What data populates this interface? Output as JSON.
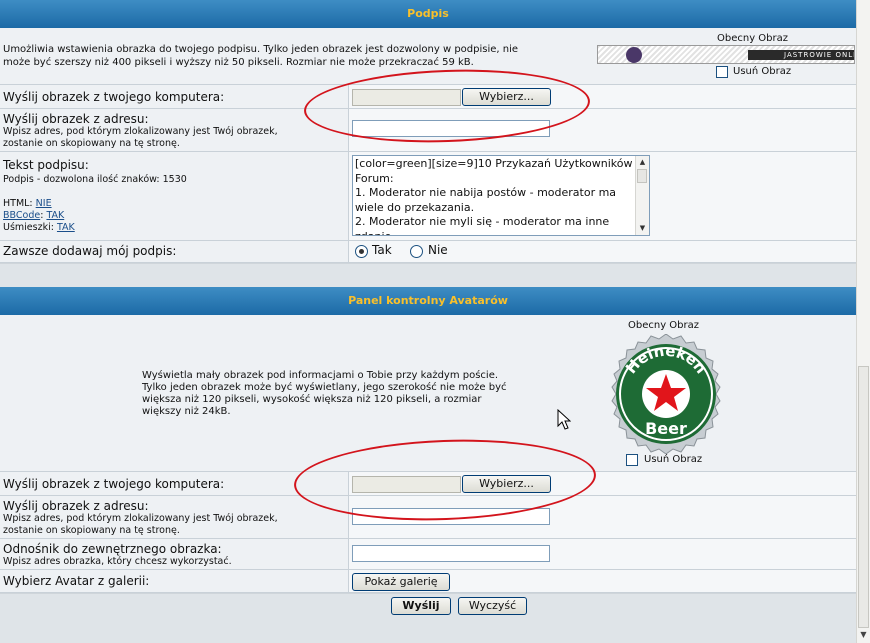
{
  "signature": {
    "header": "Podpis",
    "description_line1": "Umożliwia wstawienia obrazka do twojego podpisu. Tylko jeden obrazek jest dozwolony w podpisie, nie",
    "description_line2": "może być szerszy niż 400 pikseli i wyższy niż 50 pikseli. Rozmiar nie może przekraczać 59 kB.",
    "current_image_label": "Obecny Obraz",
    "banner_text": "JASTROWIE ONLINE",
    "remove_image_label": "Usuń Obraz",
    "upload_label": "Wyślij obrazek z twojego komputera:",
    "browse_label": "Wybierz...",
    "url_label": "Wyślij obrazek z adresu:",
    "url_help_line1": "Wpisz adres, pod którym zlokalizowany jest Twój obrazek,",
    "url_help_line2": "zostanie on skopiowany na tę stronę.",
    "url_value": "",
    "text_label": "Tekst podpisu:",
    "char_limit": "Podpis - dozwolona ilość znaków: 1530",
    "html_label": "HTML:",
    "html_value": "NIE",
    "bbcode_label": "BBCode",
    "bbcode_value": "TAK",
    "smilies_label": "Uśmieszki:",
    "smilies_value": "TAK",
    "textarea_value": "[color=green][size=9]10 Przykazań Użytkowników Forum:\n1. Moderator nie nabija postów - moderator ma wiele do przekazania.\n2. Moderator nie myli się - moderator ma inne zdanie.",
    "always_attach_label": "Zawsze dodawaj mój podpis:",
    "yes_label": "Tak",
    "no_label": "Nie",
    "always_attach_selected": "Tak"
  },
  "avatar": {
    "header": "Panel kontrolny Avatarów",
    "description_line1": "Wyświetla mały obrazek pod informacjami o Tobie przy każdym poście.",
    "description_line2": "Tylko jeden obrazek może być wyświetlany, jego szerokość nie może być",
    "description_line3": "większa niż 120 pikseli, wysokość większa niż 120 pikseli, a rozmiar",
    "description_line4": "większy niż 24kB.",
    "current_image_label": "Obecny Obraz",
    "avatar_top_text": "Heineken",
    "avatar_bottom_text": "Beer",
    "remove_image_label": "Usuń Obraz",
    "upload_label": "Wyślij obrazek z twojego komputera:",
    "browse_label": "Wybierz...",
    "url_label": "Wyślij obrazek z adresu:",
    "url_help_line1": "Wpisz adres, pod którym zlokalizowany jest Twój obrazek,",
    "url_help_line2": "zostanie on skopiowany na tę stronę.",
    "url_value": "",
    "remote_label": "Odnośnik do zewnętrznego obrazka:",
    "remote_help": "Wpisz adres obrazka, który chcesz wykorzystać.",
    "remote_value": "",
    "gallery_label": "Wybierz Avatar z galerii:",
    "gallery_button": "Pokaż galerię"
  },
  "actions": {
    "submit": "Wyślij",
    "reset": "Wyczyść"
  },
  "colors": {
    "header_bg": "#2a7bb8",
    "header_text": "#f9c02b",
    "annotation_red": "#d3141c"
  }
}
